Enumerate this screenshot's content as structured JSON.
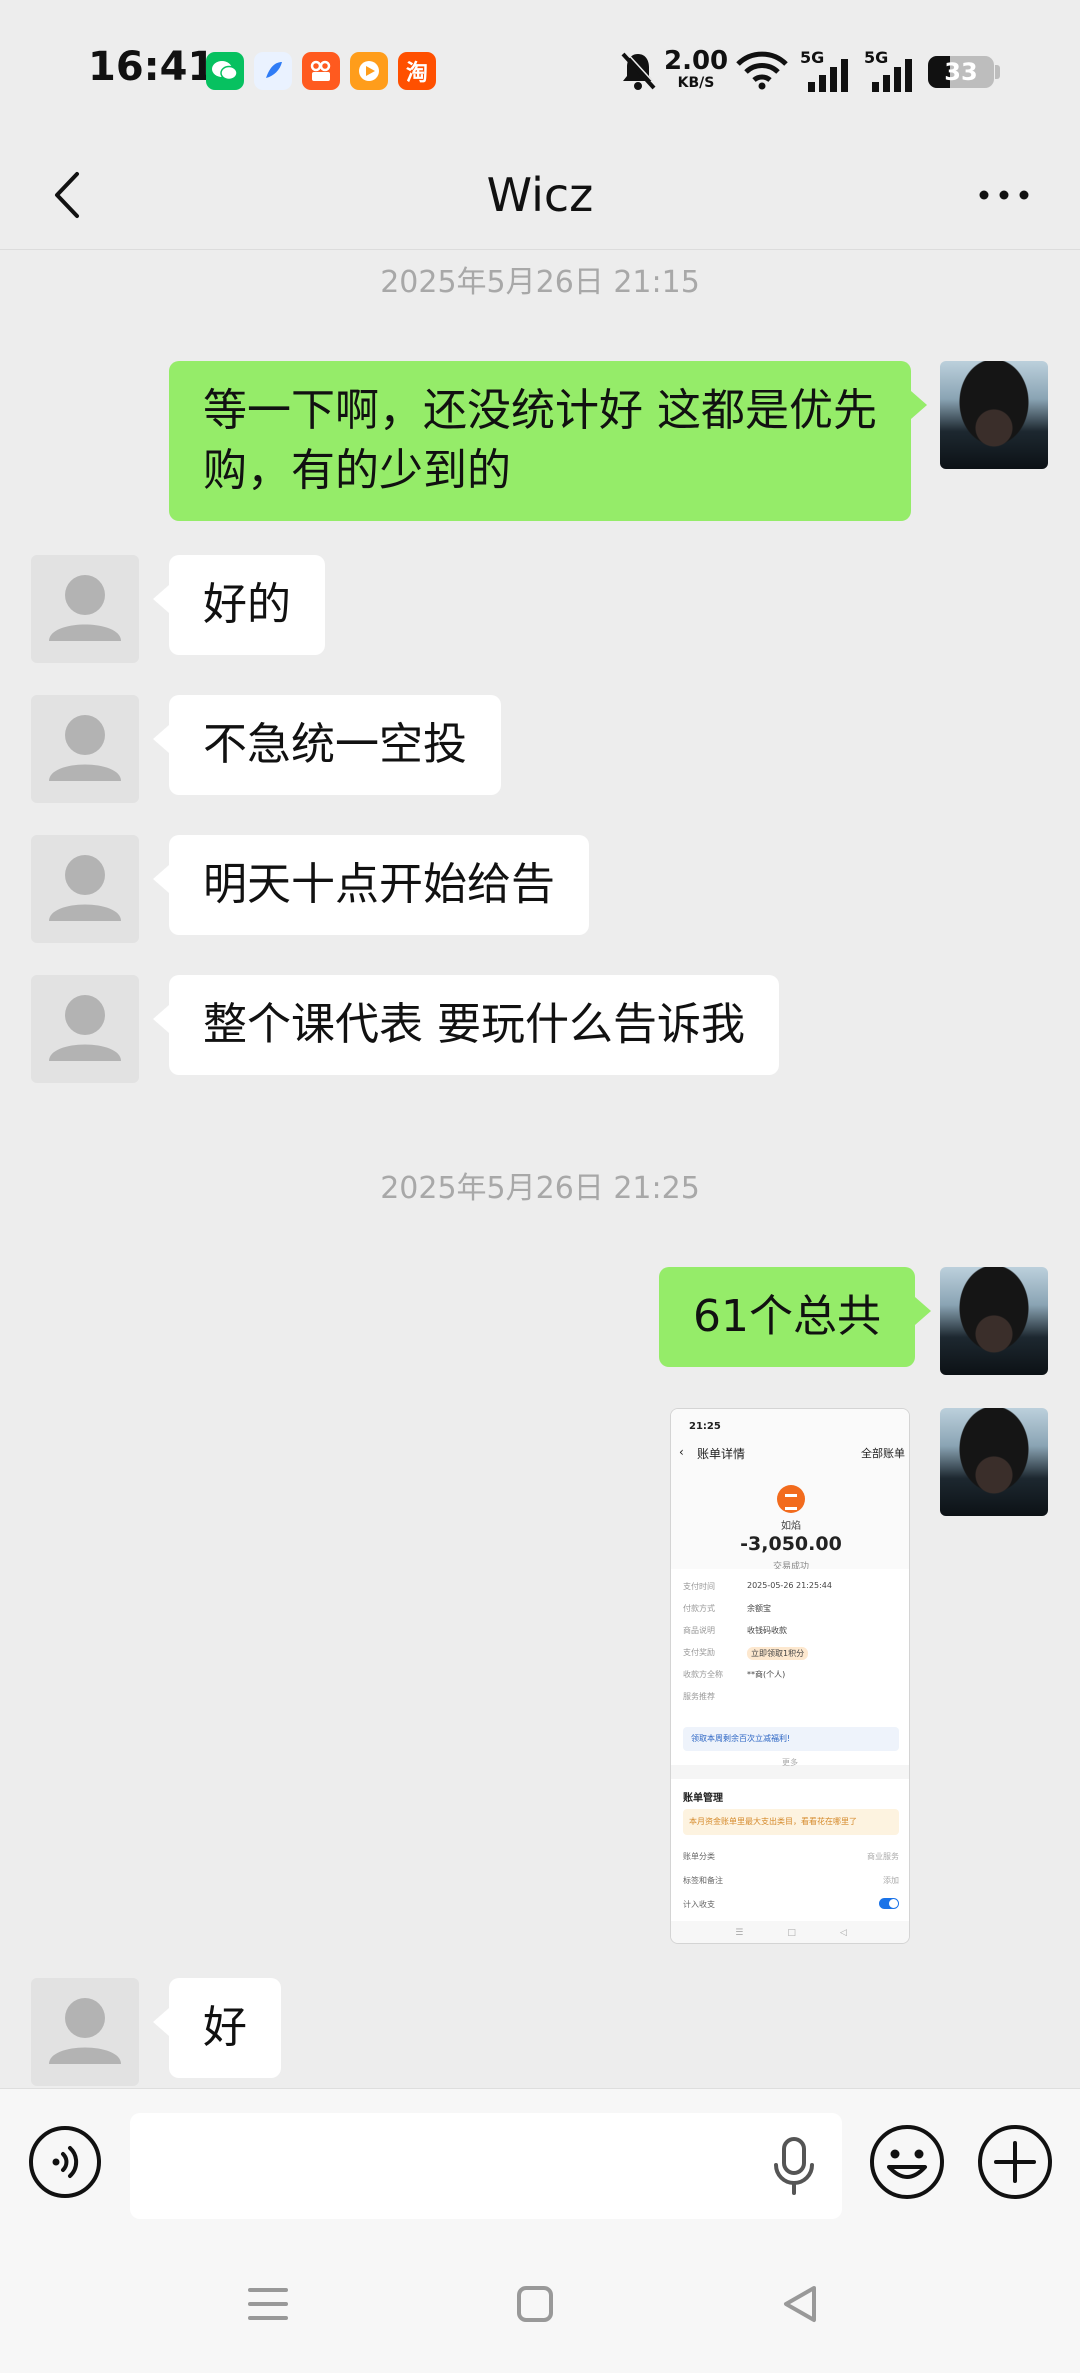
{
  "status_bar": {
    "time": "16:41",
    "app_icons": [
      "wechat-icon",
      "browser-icon",
      "kuaishou-icon",
      "video-app-icon",
      "taobao-icon"
    ],
    "taobao_glyph": "淘",
    "net_speed_value": "2.00",
    "net_speed_unit": "KB/S",
    "signal_1_label": "5G",
    "signal_2_label": "5G",
    "battery_level": "33"
  },
  "header": {
    "title": "Wicz"
  },
  "chat": {
    "timestamp_1": "2025年5月26日 21:15",
    "msg_me_1": "等一下啊，还没统计好 这都是优先购，有的少到的",
    "msg_other_1": "好的",
    "msg_other_2": "不急统一空投",
    "msg_other_3": "明天十点开始给告",
    "msg_other_4": "整个课代表 要玩什么告诉我",
    "timestamp_2": "2025年5月26日 21:25",
    "msg_me_2": "61个总共",
    "msg_other_5": "好"
  },
  "receipt_image": {
    "time": "21:25",
    "page_title": "账单详情",
    "all_bills_link": "全部账单",
    "merchant": "如焰",
    "amount": "-3,050.00",
    "state": "交易成功",
    "rows": [
      {
        "label": "支付时间",
        "value": "2025-05-26 21:25:44"
      },
      {
        "label": "付款方式",
        "value": "余额宝"
      },
      {
        "label": "商品说明",
        "value": "收钱码收款"
      },
      {
        "label": "支付奖励",
        "value": "立即领取1积分"
      },
      {
        "label": "收款方全称",
        "value": "**商(个人)"
      },
      {
        "label": "服务推荐",
        "value": ""
      }
    ],
    "banner": "领取本周剩余百次立减福利!",
    "more": "更多",
    "section_title": "账单管理",
    "notice": "本月资金账单里最大支出类目，看看花在哪里了",
    "items": [
      {
        "label": "账单分类",
        "value": "商业服务"
      },
      {
        "label": "标签和备注",
        "value": "添加"
      },
      {
        "label": "计入收支",
        "value": ""
      }
    ]
  },
  "input_bar": {
    "placeholder": ""
  },
  "colors": {
    "my_bubble": "#95ec69",
    "other_bubble": "#ffffff",
    "chat_bg": "#ededed",
    "timestamp": "#a8a8a8"
  }
}
